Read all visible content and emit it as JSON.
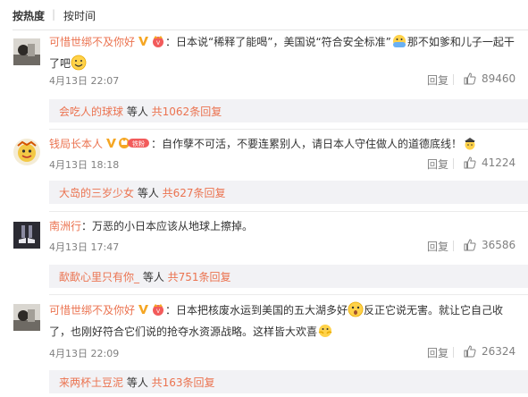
{
  "sort": {
    "hot": "按热度",
    "sep": "|",
    "time": "按时间"
  },
  "common": {
    "reply": "回复",
    "colon": "："
  },
  "comments": [
    {
      "user": "可惜世绑不及你好",
      "badge": "crown-fan",
      "text_a": "日本说“稀释了能喝”，美国说“符合安全标准”",
      "text_b": "那不如爹和儿子一起干了吧",
      "time": "4月13日 22:07",
      "likes": "89460",
      "sub_user": "会吃人的球球",
      "sub_mid": " 等人 ",
      "sub_count": "共1062条回复"
    },
    {
      "user": "钱局长本人",
      "badge": "svip-fan",
      "text_a": "自作孽不可活，不要连累别人，请日本人守住做人的道德底线！",
      "time": "4月13日 18:18",
      "likes": "41224",
      "sub_user": "大岛的三岁少女",
      "sub_mid": " 等人 ",
      "sub_count": "共627条回复"
    },
    {
      "user": "南洲行",
      "text_a": "万恶的小日本应该从地球上擦掉。",
      "time": "4月13日 17:47",
      "likes": "36586",
      "sub_user": "歃歃心里只有你_",
      "sub_mid": " 等人 ",
      "sub_count": "共751条回复"
    },
    {
      "user": "可惜世绑不及你好",
      "badge": "crown-fan",
      "text_a": "日本把核废水运到美国的五大湖多好",
      "text_b": "反正它说无害。就让它自己收",
      "text_c": "了，也刚好符合它们说的抢夺水资源战略。这样皆大欢喜",
      "time": "4月13日 22:09",
      "likes": "26324",
      "sub_user": "来两杯土豆泥",
      "sub_mid": " 等人 ",
      "sub_count": "共163条回复"
    }
  ],
  "colors": {
    "accent": "#eb7350",
    "muted": "#808080",
    "sub_bg": "#f2f2f5"
  }
}
